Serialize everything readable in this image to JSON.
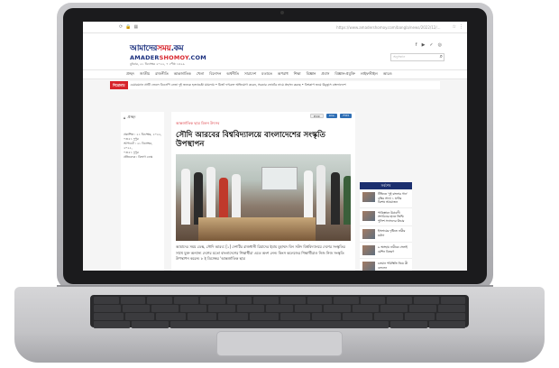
{
  "browser": {
    "url": "https://www.amadershomoy.com/bangla/news/2022/12/...",
    "tab_icons": [
      "refresh-icon",
      "lock-icon",
      "extension-icon"
    ]
  },
  "site": {
    "logo_bn_blue": "আমাদের",
    "logo_bn_red": "সময়",
    "logo_bn_suffix": ".কম",
    "logo_en_blue": "AMADER",
    "logo_en_red": "SHOMOY",
    "logo_en_suffix": ".COM",
    "dateline": "বুধবার, ২১ ডিসেম্বর ২০২২, ৭ পৌষ ১৪২৯",
    "search_placeholder": "অনুসন্ধান"
  },
  "nav": {
    "items": [
      "প্রচ্ছদ",
      "জাতীয়",
      "রাজনীতি",
      "আন্তর্জাতিক",
      "খেলা",
      "বিনোদন",
      "অর্থনীতি",
      "সারাদেশ",
      "মতামত",
      "অপরাধ",
      "শিক্ষা",
      "বিজ্ঞান",
      "প্রবাস",
      "বিজ্ঞান-প্রযুক্তি",
      "লাইফস্টাইল",
      "আরও"
    ]
  },
  "ticker": {
    "label": "শিরোনাম",
    "text": "চেয়ারম্যান প্রার্থী জেলে বিএনপি নেতা দুই জনকে হত্যাচেষ্টা মামলায় • মির্জা ফখরুল অভিযোগ করেন, সরকার ভোটের নামে প্রহসন করছে • বিশ্বকাপ জয়ে উচ্ছ্বাস বাংলাদেশে"
  },
  "left": {
    "home_label": "প্রচ্ছদ",
    "meta_lines": [
      "প্রকাশিত : ২১ ডিসেম্বর, ২০২২,",
      "০৩:৫১ দুপুর",
      "আপডেট : ২১ ডিসেম্বর, ২০২২,",
      "০৩:৫১ দুপুর",
      "প্রতিবেদক : বিভাগ ডেস্ক"
    ]
  },
  "article": {
    "print_label": "Print",
    "share_buttons": [
      "Like",
      "শেয়ার"
    ],
    "kicker": "আন্তর্জাতিক ছাত্র মিলন উৎসব",
    "headline": "সৌদি আরবের বিশ্ববিদ্যালয়ে বাংলাদেশের সংস্কৃতি উপস্থাপন",
    "body": "আমাদের সময় ডেস্ক, সৌদি আরব: [১] দেশটির রাজধানী রিয়াদের ইমাম মুহাম্মদ বিন সউদ বিশ্ববিদ্যালয়ে দেশের সংস্কৃতির সাথে যুক্ত অন্যান্য দেশের মতো বাংলাদেশের শিক্ষার্থীরা এতে অংশ নেন। কিংস কলেজের শিক্ষার্থীরাও নিজ নিজ সংস্কৃতি উপস্থাপন করেন। ৮ ই ডিসেম্বর 'আন্তর্জাতিক ছাত্র"
  },
  "sidebar": {
    "title": "সর্বশেষ",
    "items": [
      "টিভিতে 'দুই বাংলার গান' বৃত্তির সাথে ১ ঘণ্টার বিশেষ আয়োজন",
      "পাকিস্তানে উগ্রবাদী সংগঠনের হাতে জিম্মি পুলিশ সদস্যদের উদ্ধার",
      "ইসলামের দৃষ্টিতে নারীর মর্যাদা",
      "৯ অসহায় নারীকে সেলাই মেশিন বিতরণ",
      "চলমান পরিস্থিতি নিয়ে কী বললেন"
    ]
  }
}
